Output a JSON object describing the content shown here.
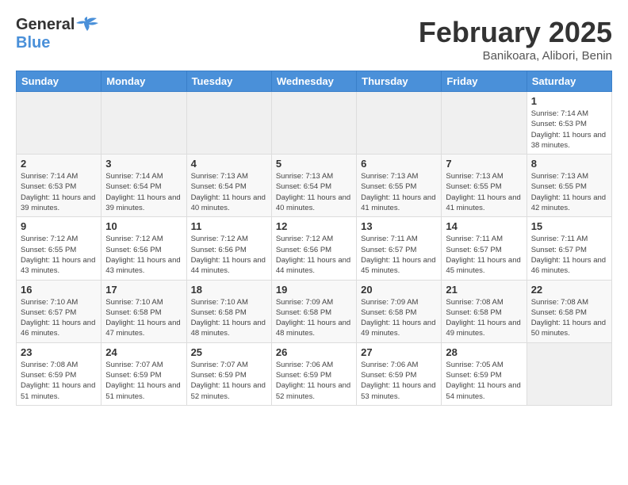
{
  "header": {
    "logo_line1": "General",
    "logo_line2": "Blue",
    "month_year": "February 2025",
    "location": "Banikoara, Alibori, Benin"
  },
  "weekdays": [
    "Sunday",
    "Monday",
    "Tuesday",
    "Wednesday",
    "Thursday",
    "Friday",
    "Saturday"
  ],
  "weeks": [
    [
      {
        "day": "",
        "info": ""
      },
      {
        "day": "",
        "info": ""
      },
      {
        "day": "",
        "info": ""
      },
      {
        "day": "",
        "info": ""
      },
      {
        "day": "",
        "info": ""
      },
      {
        "day": "",
        "info": ""
      },
      {
        "day": "1",
        "info": "Sunrise: 7:14 AM\nSunset: 6:53 PM\nDaylight: 11 hours and 38 minutes."
      }
    ],
    [
      {
        "day": "2",
        "info": "Sunrise: 7:14 AM\nSunset: 6:53 PM\nDaylight: 11 hours and 39 minutes."
      },
      {
        "day": "3",
        "info": "Sunrise: 7:14 AM\nSunset: 6:54 PM\nDaylight: 11 hours and 39 minutes."
      },
      {
        "day": "4",
        "info": "Sunrise: 7:13 AM\nSunset: 6:54 PM\nDaylight: 11 hours and 40 minutes."
      },
      {
        "day": "5",
        "info": "Sunrise: 7:13 AM\nSunset: 6:54 PM\nDaylight: 11 hours and 40 minutes."
      },
      {
        "day": "6",
        "info": "Sunrise: 7:13 AM\nSunset: 6:55 PM\nDaylight: 11 hours and 41 minutes."
      },
      {
        "day": "7",
        "info": "Sunrise: 7:13 AM\nSunset: 6:55 PM\nDaylight: 11 hours and 41 minutes."
      },
      {
        "day": "8",
        "info": "Sunrise: 7:13 AM\nSunset: 6:55 PM\nDaylight: 11 hours and 42 minutes."
      }
    ],
    [
      {
        "day": "9",
        "info": "Sunrise: 7:12 AM\nSunset: 6:55 PM\nDaylight: 11 hours and 43 minutes."
      },
      {
        "day": "10",
        "info": "Sunrise: 7:12 AM\nSunset: 6:56 PM\nDaylight: 11 hours and 43 minutes."
      },
      {
        "day": "11",
        "info": "Sunrise: 7:12 AM\nSunset: 6:56 PM\nDaylight: 11 hours and 44 minutes."
      },
      {
        "day": "12",
        "info": "Sunrise: 7:12 AM\nSunset: 6:56 PM\nDaylight: 11 hours and 44 minutes."
      },
      {
        "day": "13",
        "info": "Sunrise: 7:11 AM\nSunset: 6:57 PM\nDaylight: 11 hours and 45 minutes."
      },
      {
        "day": "14",
        "info": "Sunrise: 7:11 AM\nSunset: 6:57 PM\nDaylight: 11 hours and 45 minutes."
      },
      {
        "day": "15",
        "info": "Sunrise: 7:11 AM\nSunset: 6:57 PM\nDaylight: 11 hours and 46 minutes."
      }
    ],
    [
      {
        "day": "16",
        "info": "Sunrise: 7:10 AM\nSunset: 6:57 PM\nDaylight: 11 hours and 46 minutes."
      },
      {
        "day": "17",
        "info": "Sunrise: 7:10 AM\nSunset: 6:58 PM\nDaylight: 11 hours and 47 minutes."
      },
      {
        "day": "18",
        "info": "Sunrise: 7:10 AM\nSunset: 6:58 PM\nDaylight: 11 hours and 48 minutes."
      },
      {
        "day": "19",
        "info": "Sunrise: 7:09 AM\nSunset: 6:58 PM\nDaylight: 11 hours and 48 minutes."
      },
      {
        "day": "20",
        "info": "Sunrise: 7:09 AM\nSunset: 6:58 PM\nDaylight: 11 hours and 49 minutes."
      },
      {
        "day": "21",
        "info": "Sunrise: 7:08 AM\nSunset: 6:58 PM\nDaylight: 11 hours and 49 minutes."
      },
      {
        "day": "22",
        "info": "Sunrise: 7:08 AM\nSunset: 6:58 PM\nDaylight: 11 hours and 50 minutes."
      }
    ],
    [
      {
        "day": "23",
        "info": "Sunrise: 7:08 AM\nSunset: 6:59 PM\nDaylight: 11 hours and 51 minutes."
      },
      {
        "day": "24",
        "info": "Sunrise: 7:07 AM\nSunset: 6:59 PM\nDaylight: 11 hours and 51 minutes."
      },
      {
        "day": "25",
        "info": "Sunrise: 7:07 AM\nSunset: 6:59 PM\nDaylight: 11 hours and 52 minutes."
      },
      {
        "day": "26",
        "info": "Sunrise: 7:06 AM\nSunset: 6:59 PM\nDaylight: 11 hours and 52 minutes."
      },
      {
        "day": "27",
        "info": "Sunrise: 7:06 AM\nSunset: 6:59 PM\nDaylight: 11 hours and 53 minutes."
      },
      {
        "day": "28",
        "info": "Sunrise: 7:05 AM\nSunset: 6:59 PM\nDaylight: 11 hours and 54 minutes."
      },
      {
        "day": "",
        "info": ""
      }
    ]
  ]
}
